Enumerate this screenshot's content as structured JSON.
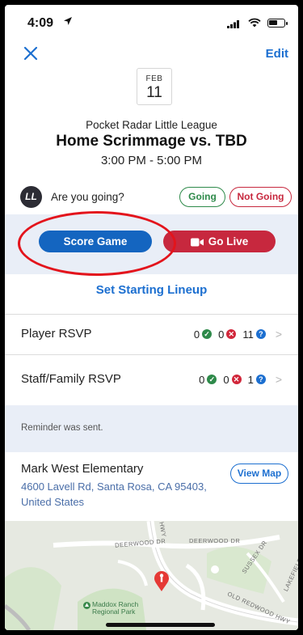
{
  "status_bar": {
    "time": "4:09"
  },
  "nav": {
    "close_icon": "close-icon",
    "edit_label": "Edit"
  },
  "event": {
    "month": "FEB",
    "day": "11",
    "league": "Pocket Radar Little League",
    "title": "Home Scrimmage vs. TBD",
    "time_range": "3:00 PM - 5:00 PM"
  },
  "rsvp_prompt": {
    "avatar_initials": "LL",
    "question": "Are you going?",
    "going_label": "Going",
    "not_going_label": "Not Going"
  },
  "actions": {
    "score_label": "Score Game",
    "live_label": "Go Live",
    "lineup_label": "Set Starting Lineup"
  },
  "rsvp_rows": [
    {
      "label": "Player RSVP",
      "yes": "0",
      "no": "0",
      "unknown": "11"
    },
    {
      "label": "Staff/Family RSVP",
      "yes": "0",
      "no": "0",
      "unknown": "1"
    }
  ],
  "reminder": {
    "text": "Reminder was sent."
  },
  "location": {
    "name": "Mark West Elementary",
    "address": "4600 Lavell Rd, Santa Rosa, CA 95403, United States",
    "map_button": "View Map"
  },
  "map": {
    "labels": [
      "DEERWOOD DR",
      "DEERWOOD DR",
      "OLD REDWOOD HWY",
      "SUSSEX DR",
      "LAKEFIELD DR",
      "HWY"
    ],
    "park": "Maddox Ranch Regional Park"
  },
  "colors": {
    "accent_blue": "#1465c0",
    "live_red": "#c7283e",
    "going_green": "#2e8a4a",
    "band_bg": "#e9eef7",
    "annotation_red": "#e3141c"
  }
}
